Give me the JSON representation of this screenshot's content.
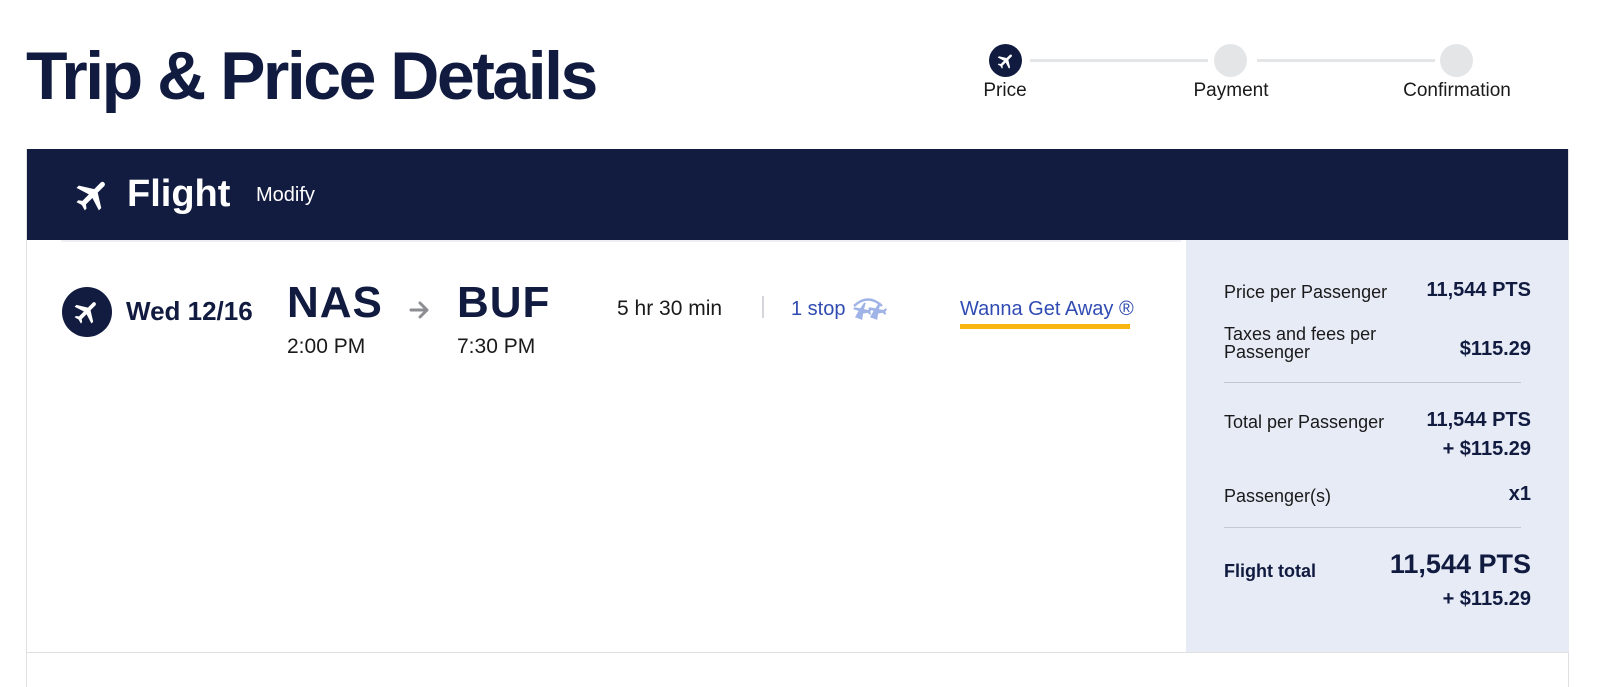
{
  "page": {
    "title": "Trip & Price Details"
  },
  "stepper": {
    "steps": [
      {
        "label": "Price",
        "state": "active"
      },
      {
        "label": "Payment",
        "state": "inactive"
      },
      {
        "label": "Confirmation",
        "state": "inactive"
      }
    ]
  },
  "flight_card": {
    "header_title": "Flight",
    "modify_label": "Modify",
    "date": "Wed 12/16",
    "origin": {
      "code": "NAS",
      "time": "2:00 PM"
    },
    "destination": {
      "code": "BUF",
      "time": "7:30 PM"
    },
    "duration": "5 hr 30 min",
    "stops": "1 stop",
    "fare_type": "Wanna Get Away ®"
  },
  "price_summary": {
    "price_per_passenger_label": "Price per Passenger",
    "price_per_passenger_value": "11,544 PTS",
    "taxes_label_line1": "Taxes and fees per",
    "taxes_label_line2": "Passenger",
    "taxes_value": "$115.29",
    "total_per_passenger_label": "Total per Passenger",
    "total_per_passenger_pts": "11,544 PTS",
    "total_per_passenger_cash": "+ $115.29",
    "passengers_label": "Passenger(s)",
    "passengers_value": "x1",
    "flight_total_label": "Flight total",
    "flight_total_pts": "11,544 PTS",
    "flight_total_cash": "+ $115.29"
  },
  "colors": {
    "navy": "#121c40",
    "link_blue": "#304cb2",
    "accent_yellow": "#f9b612",
    "summary_bg": "#e6ebf6"
  },
  "icons": {
    "header": "airplane-icon",
    "flight_badge": "airplane-icon",
    "route": "arrow-right-icon",
    "stops": "connecting-flight-icon",
    "step_active": "airplane-icon"
  }
}
